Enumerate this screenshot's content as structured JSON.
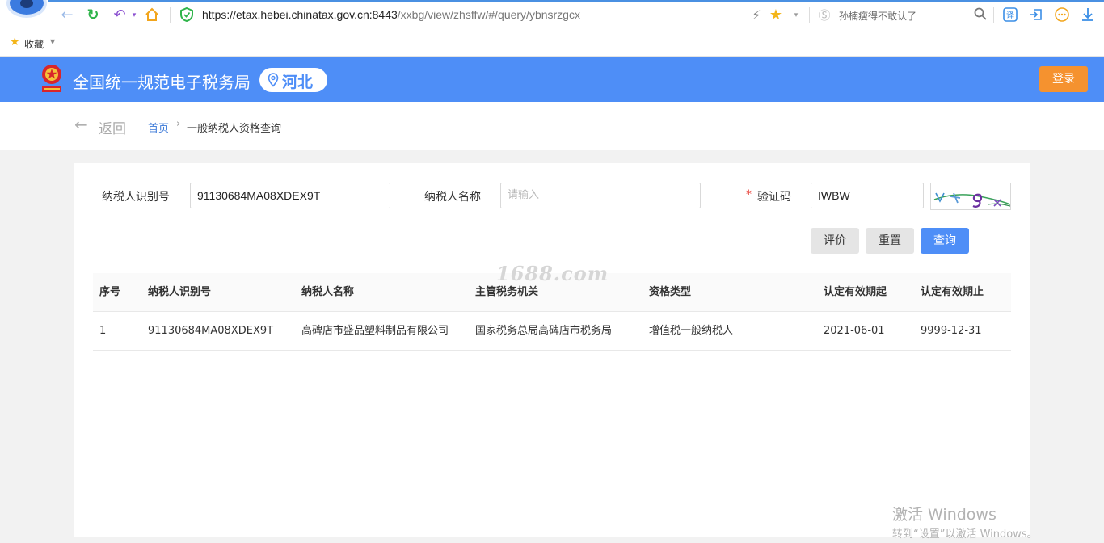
{
  "browser": {
    "url_host": "https://etax.hebei.chinatax.gov.cn:8443",
    "url_path": "/xxbg/view/zhsffw/#/query/ybnsrzgcx",
    "search_text": "孙楠瘦得不敢认了",
    "bookmark_label": "收藏"
  },
  "header": {
    "title": "全国统一规范电子税务局",
    "region": "河北",
    "login_label": "登录",
    "accent_color": "#4e8ef7",
    "login_color": "#f5922f"
  },
  "breadcrumb": {
    "back_label": "返回",
    "home": "首页",
    "separator": "›",
    "current": "一般纳税人资格查询"
  },
  "form": {
    "taxpayer_id_label": "纳税人识别号",
    "taxpayer_id_value": "91130684MA08XDEX9T",
    "taxpayer_name_label": "纳税人名称",
    "taxpayer_name_placeholder": "请输入",
    "captcha_required": "*",
    "captcha_label": "验证码",
    "captcha_value": "IWBW",
    "buttons": {
      "evaluate": "评价",
      "reset": "重置",
      "query": "查询"
    }
  },
  "watermark": "1688.com",
  "table": {
    "headers": [
      "序号",
      "纳税人识别号",
      "纳税人名称",
      "主管税务机关",
      "资格类型",
      "认定有效期起",
      "认定有效期止"
    ],
    "rows": [
      [
        "1",
        "91130684MA08XDEX9T",
        "高碑店市盛品塑料制品有限公司",
        "国家税务总局高碑店市税务局",
        "增值税一般纳税人",
        "2021-06-01",
        "9999-12-31"
      ]
    ]
  },
  "windows_activation": {
    "title": "激活 Windows",
    "subtitle": "转到“设置”以激活 Windows。"
  }
}
